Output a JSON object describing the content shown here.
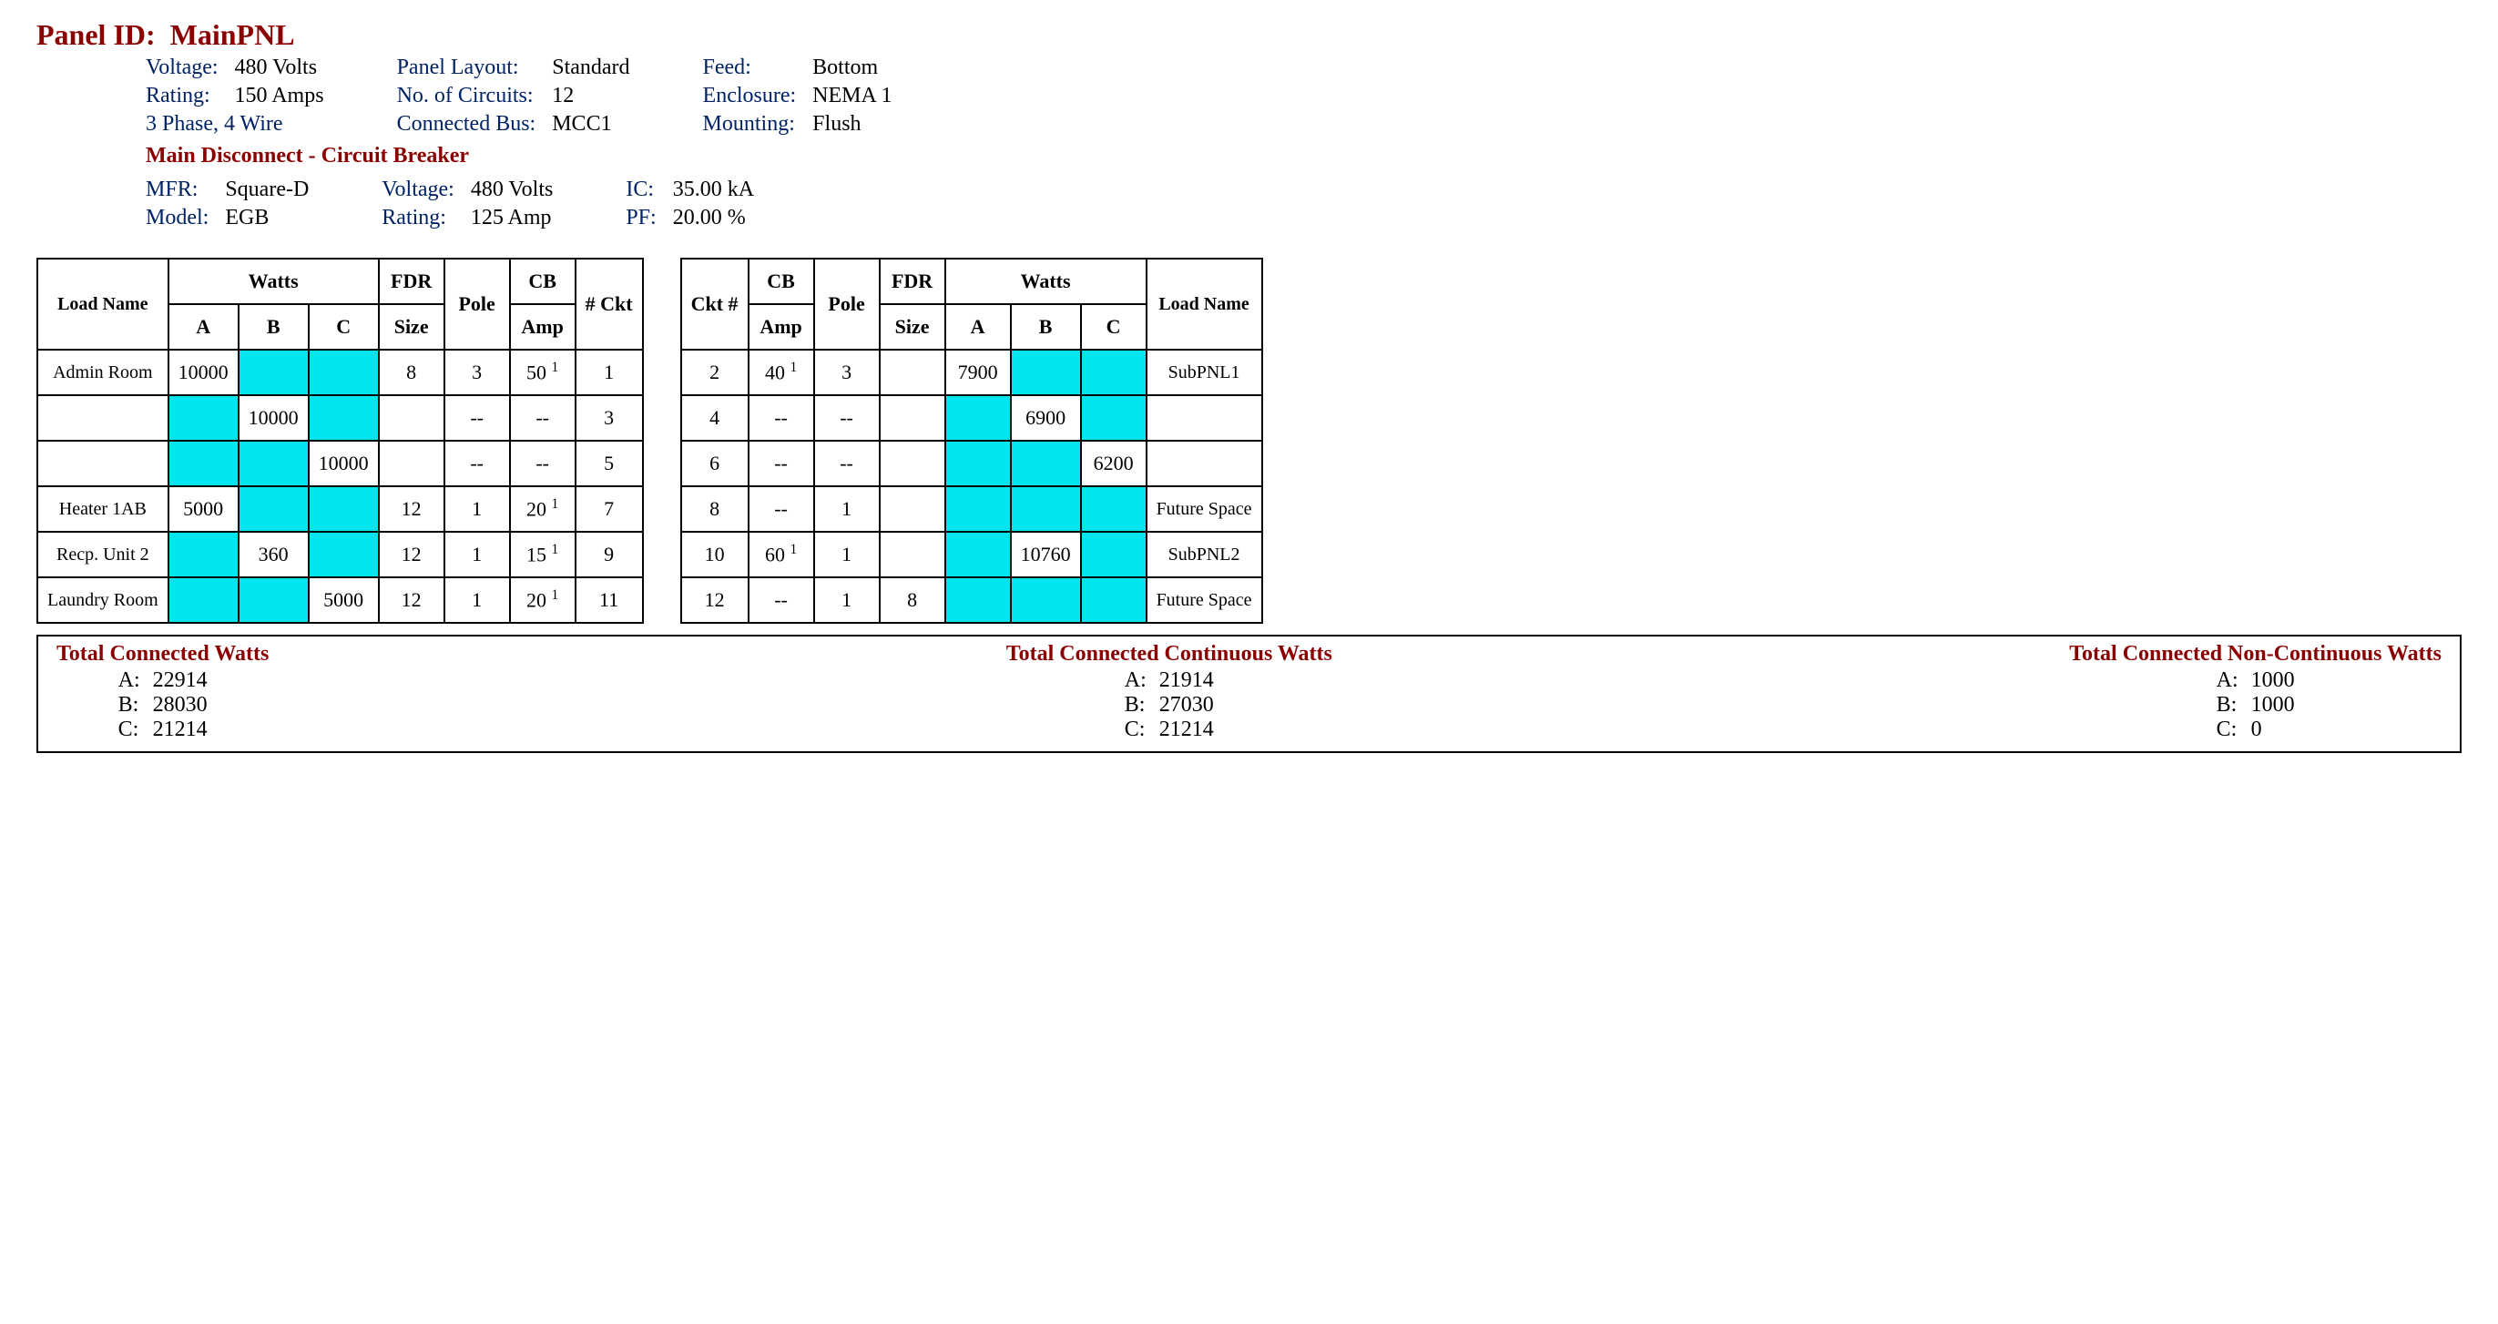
{
  "title_label": "Panel ID:",
  "title_value": "MainPNL",
  "header": {
    "voltage_label": "Voltage:",
    "voltage": "480 Volts",
    "rating_label": "Rating:",
    "rating": "150 Amps",
    "phase_wire": "3 Phase, 4 Wire",
    "layout_label": "Panel Layout:",
    "layout": "Standard",
    "circuits_label": "No. of Circuits:",
    "circuits": "12",
    "bus_label": "Connected Bus:",
    "bus": "MCC1",
    "feed_label": "Feed:",
    "feed": "Bottom",
    "enclosure_label": "Enclosure:",
    "enclosure": "NEMA 1",
    "mounting_label": "Mounting:",
    "mounting": "Flush"
  },
  "disconnect": {
    "title": "Main Disconnect - Circuit Breaker",
    "mfr_label": "MFR:",
    "mfr": "Square-D",
    "model_label": "Model:",
    "model": "EGB",
    "voltage_label": "Voltage:",
    "voltage": "480 Volts",
    "rating_label": "Rating:",
    "rating": "125 Amp",
    "ic_label": "IC:",
    "ic": "35.00 kA",
    "pf_label": "PF:",
    "pf": "20.00 %"
  },
  "tableHeaders": {
    "loadName": "Load Name",
    "watts": "Watts",
    "a": "A",
    "b": "B",
    "c": "C",
    "fdr": "FDR",
    "size": "Size",
    "pole": "Pole",
    "cb": "CB",
    "amp": "Amp",
    "ckt": "# Ckt",
    "cktNum": "Ckt #"
  },
  "leftRows": [
    {
      "load": "Admin Room",
      "a": "10000",
      "aHi": false,
      "b": "",
      "bHi": true,
      "c": "",
      "cHi": true,
      "fdr": "8",
      "pole": "3",
      "cb": "50",
      "cbSup": "1",
      "ckt": "1"
    },
    {
      "load": "",
      "a": "",
      "aHi": true,
      "b": "10000",
      "bHi": false,
      "c": "",
      "cHi": true,
      "fdr": "",
      "pole": "--",
      "cb": "--",
      "cbSup": "",
      "ckt": "3"
    },
    {
      "load": "",
      "a": "",
      "aHi": true,
      "b": "",
      "bHi": true,
      "c": "10000",
      "cHi": false,
      "fdr": "",
      "pole": "--",
      "cb": "--",
      "cbSup": "",
      "ckt": "5"
    },
    {
      "load": "Heater 1AB",
      "a": "5000",
      "aHi": false,
      "b": "",
      "bHi": true,
      "c": "",
      "cHi": true,
      "fdr": "12",
      "pole": "1",
      "cb": "20",
      "cbSup": "1",
      "ckt": "7"
    },
    {
      "load": "Recp. Unit 2",
      "a": "",
      "aHi": true,
      "b": "360",
      "bHi": false,
      "c": "",
      "cHi": true,
      "fdr": "12",
      "pole": "1",
      "cb": "15",
      "cbSup": "1",
      "ckt": "9"
    },
    {
      "load": "Laundry Room",
      "a": "",
      "aHi": true,
      "b": "",
      "bHi": true,
      "c": "5000",
      "cHi": false,
      "fdr": "12",
      "pole": "1",
      "cb": "20",
      "cbSup": "1",
      "ckt": "11"
    }
  ],
  "rightRows": [
    {
      "ckt": "2",
      "cb": "40",
      "cbSup": "1",
      "pole": "3",
      "fdr": "",
      "a": "7900",
      "aHi": false,
      "b": "",
      "bHi": true,
      "c": "",
      "cHi": true,
      "load": "SubPNL1"
    },
    {
      "ckt": "4",
      "cb": "--",
      "cbSup": "",
      "pole": "--",
      "fdr": "",
      "a": "",
      "aHi": true,
      "b": "6900",
      "bHi": false,
      "c": "",
      "cHi": true,
      "load": ""
    },
    {
      "ckt": "6",
      "cb": "--",
      "cbSup": "",
      "pole": "--",
      "fdr": "",
      "a": "",
      "aHi": true,
      "b": "",
      "bHi": true,
      "c": "6200",
      "cHi": false,
      "load": ""
    },
    {
      "ckt": "8",
      "cb": "--",
      "cbSup": "",
      "pole": "1",
      "fdr": "",
      "a": "",
      "aHi": true,
      "b": "",
      "bHi": true,
      "c": "",
      "cHi": true,
      "load": "Future Space"
    },
    {
      "ckt": "10",
      "cb": "60",
      "cbSup": "1",
      "pole": "1",
      "fdr": "",
      "a": "",
      "aHi": true,
      "b": "10760",
      "bHi": false,
      "c": "",
      "cHi": true,
      "load": "SubPNL2"
    },
    {
      "ckt": "12",
      "cb": "--",
      "cbSup": "",
      "pole": "1",
      "fdr": "8",
      "a": "",
      "aHi": true,
      "b": "",
      "bHi": true,
      "c": "",
      "cHi": true,
      "load": "Future Space"
    }
  ],
  "totals": {
    "connected": {
      "title": "Total Connected Watts",
      "a": "22914",
      "b": "28030",
      "c": "21214"
    },
    "continuous": {
      "title": "Total Connected Continuous Watts",
      "a": "21914",
      "b": "27030",
      "c": "21214"
    },
    "noncontinuous": {
      "title": "Total Connected Non-Continuous Watts",
      "a": "1000",
      "b": "1000",
      "c": "0"
    }
  }
}
